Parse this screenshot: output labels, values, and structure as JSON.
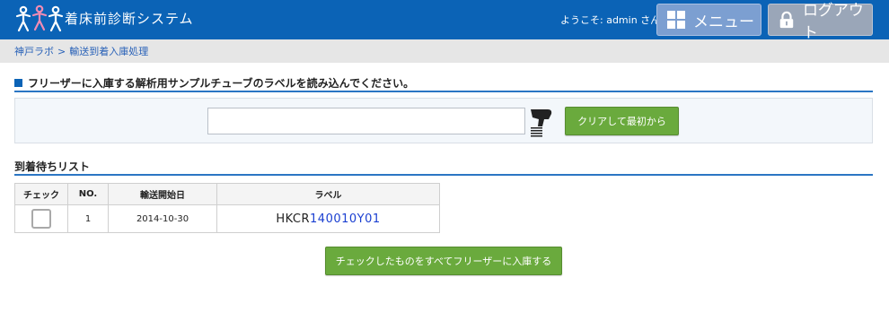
{
  "header": {
    "app_title": "着床前診断システム",
    "welcome": "ようこそ: admin さん",
    "menu_label": "メニュー",
    "logout_label": "ログアウト"
  },
  "breadcrumb": {
    "items": [
      "神戸ラボ",
      "輸送到着入庫処理"
    ],
    "separator": ">"
  },
  "scan_section": {
    "heading": "フリーザーに入庫する解析用サンプルチューブのラベルを読み込んでください。",
    "input_value": "",
    "clear_button": "クリアして最初から"
  },
  "arrival_list": {
    "heading": "到着待ちリスト",
    "columns": [
      "チェック",
      "NO.",
      "輸送開始日",
      "ラベル"
    ],
    "rows": [
      {
        "checked": false,
        "no": "1",
        "date": "2014-10-30",
        "label_prefix": "HKCR",
        "label_highlight": "140010",
        "label_suffix": "Y01"
      }
    ]
  },
  "submit_button": "チェックしたものをすべてフリーザーに入庫する",
  "colors": {
    "header_bg": "#0b63b6",
    "accent_green": "#6aaa3d",
    "label_highlight": "#1a3fd1"
  },
  "icons": {
    "logo": "people-logo-icon",
    "menu": "grid-icon",
    "logout": "lock-icon",
    "scanner": "barcode-scanner-icon"
  }
}
